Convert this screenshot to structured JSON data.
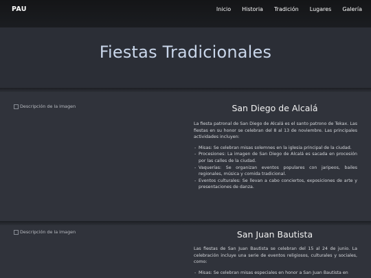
{
  "nav": {
    "brand": "PAU",
    "items": [
      "Inicio",
      "Historia",
      "Tradición",
      "Lugares",
      "Galería"
    ]
  },
  "hero": {
    "title": "Fiestas Tradicionales"
  },
  "sections": [
    {
      "img_alt": "Descripción de la imagen",
      "title": "San Diego de Alcalá",
      "intro": "La fiesta patronal de San Diego de Alcalá es el santo patrono de Tekax. Las fiestas en su honor se celebran del 8 al 13 de noviembre. Las principales actividades incluyen:",
      "bullets": [
        "Misas: Se celebran misas solemnes en la iglesia principal de la ciudad.",
        "Procesiones: La imagen de San Diego de Alcalá es sacada en procesión por las calles de la ciudad.",
        "Vaquerías: Se organizan eventos populares con jaripeos, bailes regionales, música y comida tradicional.",
        "Eventos culturales: Se llevan a cabo conciertos, exposiciones de arte y presentaciones de danza."
      ]
    },
    {
      "img_alt": "Descripción de la imagen",
      "title": "San Juan Bautista",
      "intro": "Las fiestas de San Juan Bautista se celebran del 15 al 24 de junio. La celebración incluye una serie de eventos religiosos, culturales y sociales, como:",
      "bullets": [
        "Misas: Se celebran misas especiales en honor a San Juan Bautista en"
      ]
    }
  ]
}
